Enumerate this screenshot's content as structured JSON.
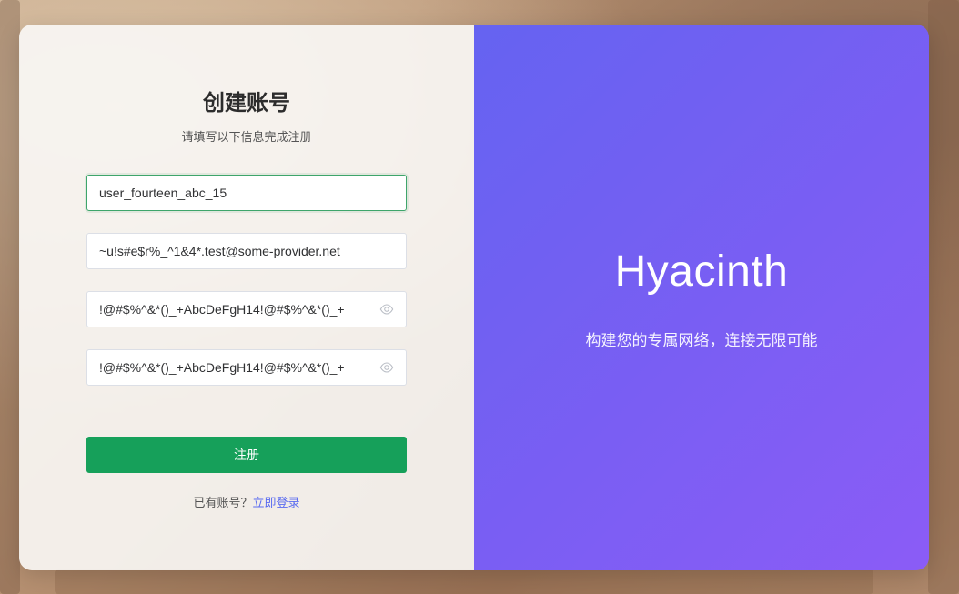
{
  "form": {
    "title": "创建账号",
    "subtitle": "请填写以下信息完成注册",
    "username_value": "user_fourteen_abc_15",
    "email_value": "~u!s#e$r%_^1&4*.test@some-provider.net",
    "password_value": "!@#$%^&*()_+AbcDeFgH14!@#$%^&*()_+",
    "confirm_password_value": "!@#$%^&*()_+AbcDeFgH14!@#$%^&*()_+",
    "password_toggle_icon": "eye-icon",
    "submit_label": "注册",
    "login_prompt": "已有账号？",
    "login_link": "立即登录"
  },
  "brand_panel": {
    "name": "Hyacinth",
    "tagline": "构建您的专属网络，连接无限可能"
  },
  "colors": {
    "primary_button": "#16a05a",
    "active_border": "#3ea56b",
    "link": "#5a6bf0",
    "panel_gradient_start": "#6563f1",
    "panel_gradient_end": "#8b5cf6"
  }
}
